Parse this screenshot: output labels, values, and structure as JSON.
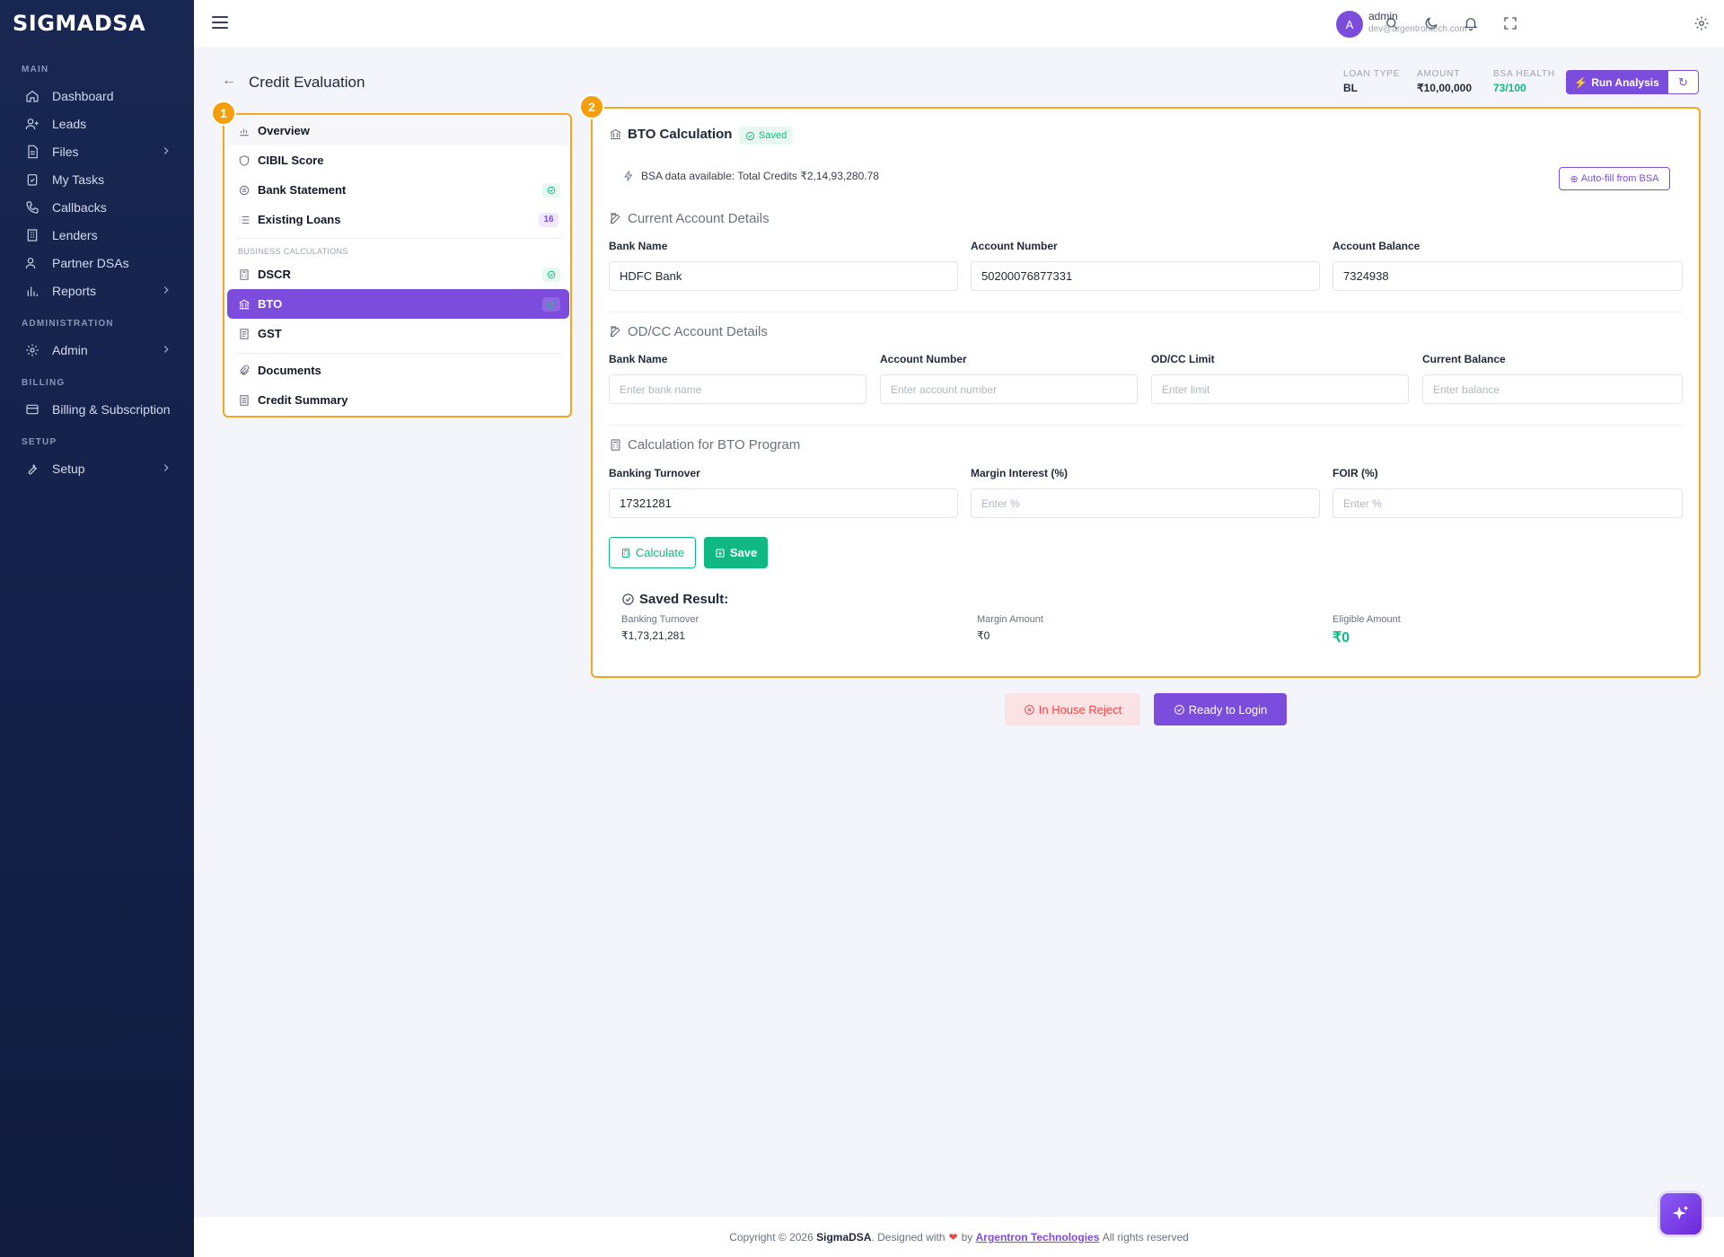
{
  "brand": {
    "logo_text": "SIGMADSA"
  },
  "sidebar": {
    "sections": [
      {
        "title": "MAIN"
      },
      {
        "title": "ADMINISTRATION"
      },
      {
        "title": "BILLING"
      },
      {
        "title": "SETUP"
      }
    ],
    "items": [
      {
        "label": "Dashboard",
        "icon": "home-icon"
      },
      {
        "label": "Leads",
        "icon": "user-plus-icon"
      },
      {
        "label": "Files",
        "icon": "file-icon"
      },
      {
        "label": "My Tasks",
        "icon": "clipboard-check-icon"
      },
      {
        "label": "Callbacks",
        "icon": "phone-icon"
      },
      {
        "label": "Lenders",
        "icon": "building-icon"
      },
      {
        "label": "Partner DSAs",
        "icon": "users-icon"
      },
      {
        "label": "Reports",
        "icon": "bar-chart-icon"
      },
      {
        "label": "Admin",
        "icon": "gear-icon"
      },
      {
        "label": "Billing & Subscription",
        "icon": "credit-card-icon"
      },
      {
        "label": "Setup",
        "icon": "wrench-icon"
      }
    ]
  },
  "topbar": {
    "user": {
      "avatar_letter": "A",
      "name": "admin",
      "email": "dev@argentrontech.com"
    }
  },
  "page": {
    "title": "Credit Evaluation",
    "stats": [
      {
        "label": "LOAN TYPE",
        "value": "BL"
      },
      {
        "label": "AMOUNT",
        "value": "₹10,00,000"
      },
      {
        "label": "BSA HEALTH",
        "value": "73/100"
      }
    ],
    "run_analysis_label": "Run Analysis"
  },
  "left_menu": {
    "badge": "1",
    "items": [
      {
        "label": "Overview"
      },
      {
        "label": "CIBIL Score"
      },
      {
        "label": "Bank Statement"
      },
      {
        "label": "Existing Loans",
        "count": "16"
      },
      {
        "label": "DSCR"
      },
      {
        "label": "BTO"
      },
      {
        "label": "GST"
      },
      {
        "label": "Documents"
      },
      {
        "label": "Credit Summary"
      }
    ],
    "section_label": "BUSINESS CALCULATIONS"
  },
  "main": {
    "badge": "2",
    "title": "BTO Calculation",
    "saved_label": "Saved",
    "bsa_info": "BSA data available: Total Credits ₹2,14,93,280.78",
    "autofill_label": "Auto-fill from BSA",
    "current_account": {
      "title": "Current Account Details",
      "bank_name_label": "Bank Name",
      "bank_name_value": "HDFC Bank",
      "account_number_label": "Account Number",
      "account_number_value": "50200076877331",
      "account_balance_label": "Account Balance",
      "account_balance_value": "7324938"
    },
    "odcc_account": {
      "title": "OD/CC Account Details",
      "bank_name_label": "Bank Name",
      "bank_name_placeholder": "Enter bank name",
      "account_number_label": "Account Number",
      "account_number_placeholder": "Enter account number",
      "limit_label": "OD/CC Limit",
      "limit_placeholder": "Enter limit",
      "balance_label": "Current Balance",
      "balance_placeholder": "Enter balance"
    },
    "bto_program": {
      "title": "Calculation for BTO Program",
      "turnover_label": "Banking Turnover",
      "turnover_value": "17321281",
      "margin_label": "Margin Interest (%)",
      "margin_placeholder": "Enter %",
      "foir_label": "FOIR (%)",
      "foir_placeholder": "Enter %"
    },
    "calculate_label": "Calculate",
    "save_label": "Save",
    "result": {
      "title": "Saved Result:",
      "turnover_label": "Banking Turnover",
      "turnover_value": "₹1,73,21,281",
      "margin_label": "Margin Amount",
      "margin_value": "₹0",
      "eligible_label": "Eligible Amount",
      "eligible_value": "₹0"
    }
  },
  "actions": {
    "reject_label": "In House Reject",
    "login_label": "Ready to Login"
  },
  "footer": {
    "prefix": "Copyright © 2026",
    "brand": "SigmaDSA",
    "middle": ". Designed with",
    "by": "by",
    "company": "Argentron Technologies",
    "suffix": "All rights reserved"
  },
  "colors": {
    "accent": "#7c4ddc",
    "success": "#10b981",
    "highlight": "#f4a620",
    "danger": "#ef4444",
    "sidebar": "#14214a"
  }
}
